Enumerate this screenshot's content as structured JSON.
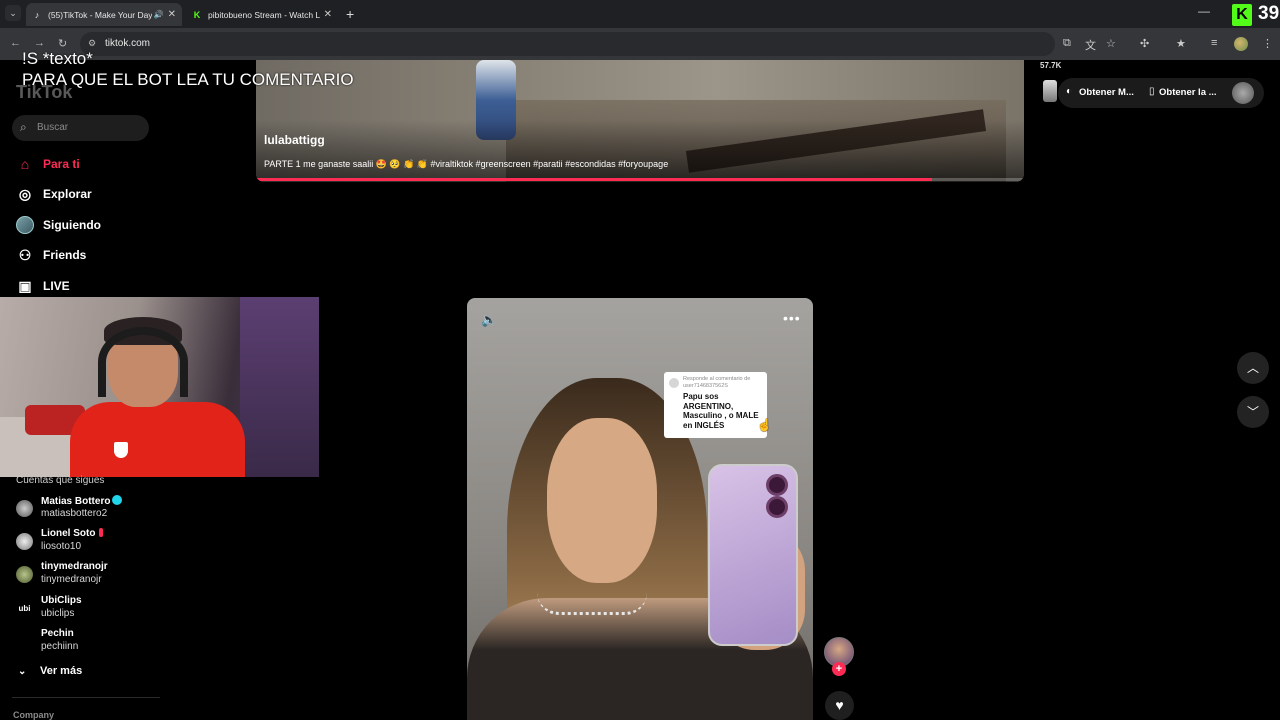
{
  "browser": {
    "tabs": [
      {
        "title": "(55)TikTok - Make Your Day",
        "active": true
      },
      {
        "title": "pibitobueno Stream - Watch Li",
        "active": false
      }
    ],
    "url": "tiktok.com",
    "viewer_count": "39",
    "new_tab_icon": "plus-icon"
  },
  "overlay": {
    "command_line": "!S *texto*",
    "instruction_line": "PARA  QUE EL BOT LEA TU COMENTARIO"
  },
  "sidebar": {
    "logo": "TikTok",
    "search_placeholder": "Buscar",
    "nav": [
      {
        "label": "Para ti",
        "icon": "home-icon",
        "active": true
      },
      {
        "label": "Explorar",
        "icon": "compass-icon",
        "active": false
      },
      {
        "label": "Siguiendo",
        "icon": "avatar-icon",
        "active": false
      },
      {
        "label": "Friends",
        "icon": "friends-icon",
        "active": false
      },
      {
        "label": "LIVE",
        "icon": "live-icon",
        "active": false
      }
    ],
    "following_title": "Cuentas que sigues",
    "following": [
      {
        "name": "Matias Bottero",
        "username": "matiasbottero2",
        "badge": "verified"
      },
      {
        "name": "Lionel Soto",
        "username": "liosoto10",
        "badge": "live"
      },
      {
        "name": "tinymedranojr",
        "username": "tinymedranojr",
        "badge": ""
      },
      {
        "name": "UbiClips",
        "username": "ubiclips",
        "badge": ""
      },
      {
        "name": "Pechin",
        "username": "pechiinn",
        "badge": ""
      }
    ],
    "see_more": "Ver más",
    "company": "Company"
  },
  "top_video": {
    "author": "lulabattigg",
    "caption": "PARTE 1 me ganaste saalii 🤩 🥺 👏 👏 #viraltiktok #greenscreen #paratii #escondidas #foryoupage",
    "progress": 0.88
  },
  "top_right": {
    "likes": "57.7K",
    "get_app_1": "Obtener M...",
    "get_app_2": "Obtener la ..."
  },
  "main_video": {
    "reply_header": "Responde al comentario de user7146837562S",
    "reply_text": "Papu sos ARGENTINO, Masculino , o MALE en INGLÉS"
  },
  "colors": {
    "accent": "#fe2c55",
    "verified": "#20d5ec",
    "kick": "#53fc18"
  }
}
